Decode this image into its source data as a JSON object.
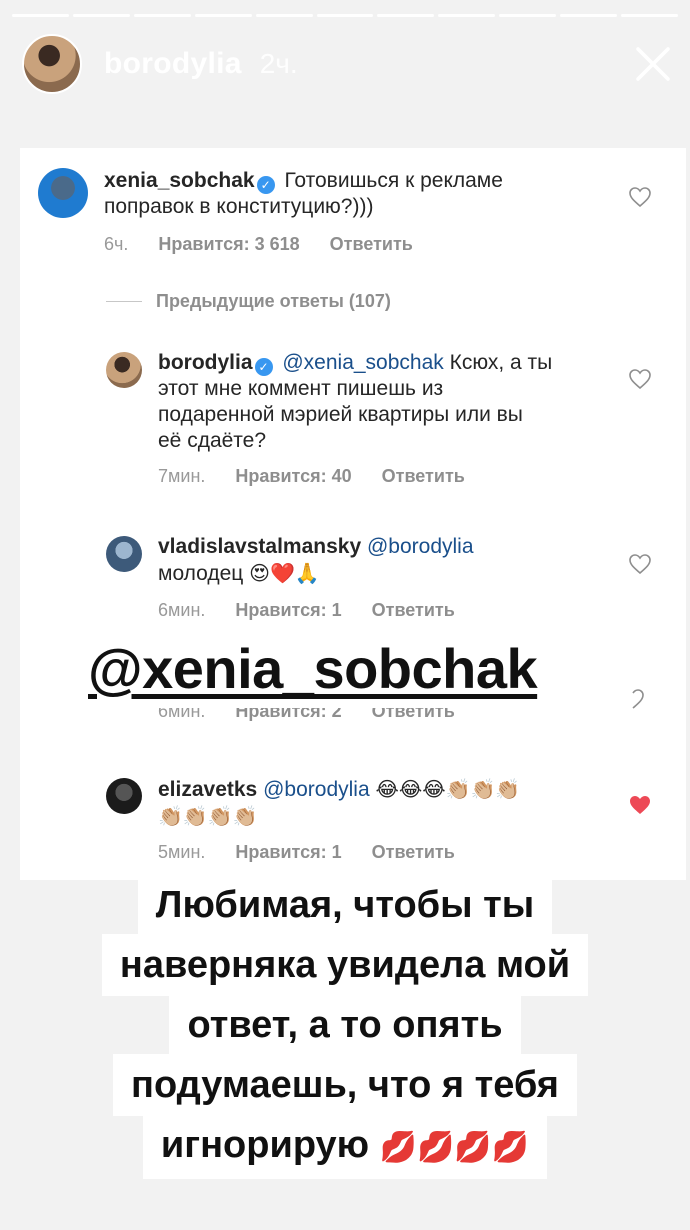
{
  "story": {
    "username": "borodylia",
    "time": "2ч.",
    "progress_segments": 11
  },
  "comments": [
    {
      "user": "xenia_sobchak",
      "verified": true,
      "mention": "",
      "text_line1": "Готовишься к рекламе",
      "text_line2": "поправок в конституцию?)))",
      "time": "6ч.",
      "likes": "Нравится: 3 618",
      "reply": "Ответить"
    },
    {
      "user": "borodylia",
      "verified": true,
      "mention": "@xenia_sobchak",
      "text_line1": "Ксюх, а ты",
      "text_line2": "этот мне коммент пишешь из",
      "text_line3": "подаренной мэрией квартиры или вы",
      "text_line4": "её сдаёте?",
      "time": "7мин.",
      "likes": "Нравится: 40",
      "reply": "Ответить"
    },
    {
      "user": "vladislavstalmansky",
      "verified": false,
      "mention": "@borodylia",
      "text_line2": "молодец",
      "emoji": "😍❤️🙏",
      "time": "6мин.",
      "likes": "Нравится: 1",
      "reply": "Ответить"
    },
    {
      "time": "6мин.",
      "likes": "Нравится: 2",
      "reply": "Ответить"
    },
    {
      "user": "elizavetks",
      "verified": false,
      "mention": "@borodylia",
      "emoji_line1": "😂😂😂👏🏼👏🏼👏🏼",
      "emoji_line2": "👏🏼👏🏼👏🏼👏🏼",
      "time": "5мин.",
      "likes": "Нравится: 1",
      "reply": "Ответить",
      "liked": true
    }
  ],
  "previous_replies": "Предыдущие ответы (107)",
  "sticker_mention": "@xenia_sobchak",
  "caption_lines": [
    "Любимая, чтобы ты",
    "наверняка увидела мой",
    "ответ, а то опять",
    "подумаешь, что я тебя",
    "игнорирую"
  ],
  "caption_emoji": "💋💋💋💋",
  "colors": {
    "heart_liked": "#ed4956",
    "mention": "#1a4f8b",
    "verified": "#3897f0"
  }
}
